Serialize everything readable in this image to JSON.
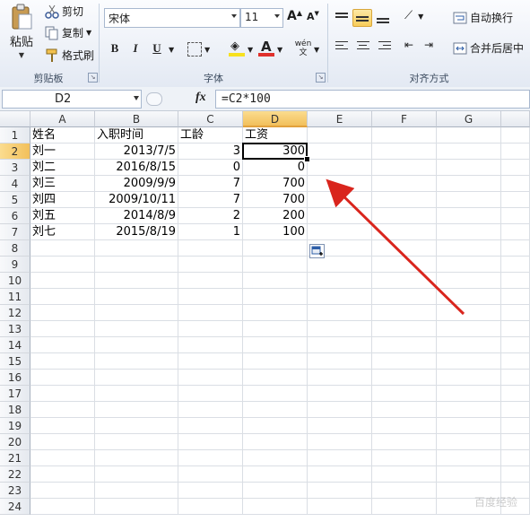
{
  "ribbon": {
    "clipboard": {
      "paste_label": "粘贴",
      "cut_label": "剪切",
      "copy_label": "复制",
      "format_painter_label": "格式刷",
      "group_label": "剪贴板"
    },
    "font": {
      "font_name": "宋体",
      "font_size": "11",
      "grow_label": "A",
      "shrink_label": "A",
      "bold_label": "B",
      "italic_label": "I",
      "underline_label": "U",
      "font_color_label": "A",
      "phonetic_label": "wén 文",
      "group_label": "字体",
      "accent_fill": "#f7e11f",
      "accent_font": "#e0312c"
    },
    "alignment": {
      "wrap_text_label": "自动换行",
      "merge_center_label": "合并后居中",
      "group_label": "对齐方式"
    }
  },
  "formula_bar": {
    "name_box": "D2",
    "fx_label": "fx",
    "formula": "=C2*100"
  },
  "sheet": {
    "columns": [
      "A",
      "B",
      "C",
      "D",
      "E",
      "F",
      "G"
    ],
    "active_column": "D",
    "active_row": 2,
    "rows": [
      [
        "姓名",
        "入职时间",
        "工龄",
        "工资"
      ],
      [
        "刘一",
        "2013/7/5",
        "3",
        "300"
      ],
      [
        "刘二",
        "2016/8/15",
        "0",
        "0"
      ],
      [
        "刘三",
        "2009/9/9",
        "7",
        "700"
      ],
      [
        "刘四",
        "2009/10/11",
        "7",
        "700"
      ],
      [
        "刘五",
        "2014/8/9",
        "2",
        "200"
      ],
      [
        "刘七",
        "2015/8/19",
        "1",
        "100"
      ]
    ],
    "row_numbers": [
      "1",
      "2",
      "3",
      "4",
      "5",
      "6",
      "7",
      "8",
      "9",
      "10",
      "11",
      "12",
      "13",
      "14",
      "15",
      "16",
      "17",
      "18",
      "19",
      "20",
      "21",
      "22",
      "23",
      "24"
    ]
  },
  "annotation": {
    "arrow_color": "#d9251d"
  },
  "watermark": "百度经验"
}
